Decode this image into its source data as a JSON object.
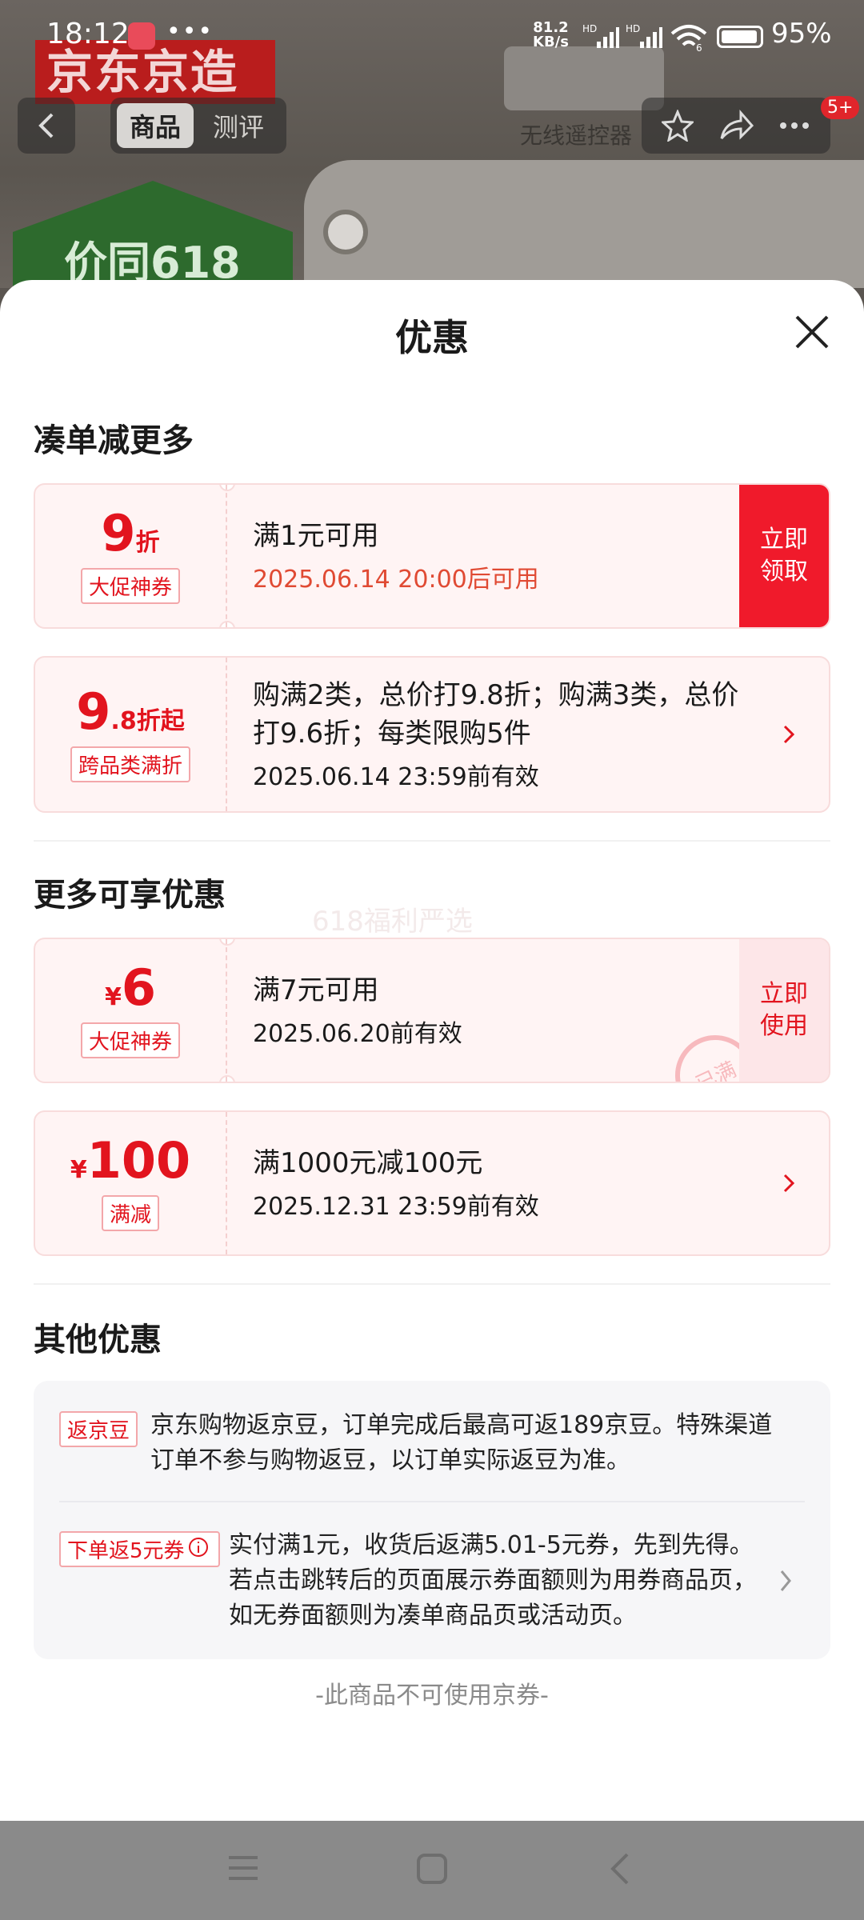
{
  "status_bar": {
    "time": "18:12",
    "more": "•••",
    "net_speed": "81.2",
    "net_unit": "KB/s",
    "signal_tag_1": "HD",
    "signal_tag_2": "HD",
    "wifi_level": "6",
    "battery": "95%"
  },
  "background": {
    "brand": "京东京造",
    "remote_label": "无线遥控器",
    "badge_text": "价同618"
  },
  "nav": {
    "tabs": [
      {
        "label": "商品"
      },
      {
        "label": "测评"
      }
    ],
    "notification_count": "5+"
  },
  "sheet": {
    "title": "优惠",
    "section_combine": "凑单减更多",
    "section_more": "更多可享优惠",
    "section_other": "其他优惠",
    "watermark": "618福利严选",
    "coupons": [
      {
        "value_big": "9",
        "value_small": "折",
        "tag": "大促神券",
        "main": "满1元可用",
        "sub": "2025.06.14 20:00后可用",
        "action": "立即领取"
      },
      {
        "value_big": "9",
        "value_small": ".8折起",
        "tag": "跨品类满折",
        "main": "购满2类，总价打9.8折；购满3类，总价打9.6折；每类限购5件",
        "sub": "2025.06.14 23:59前有效"
      },
      {
        "value_prefix": "¥",
        "value_big": "6",
        "tag": "大促神券",
        "main": "满7元可用",
        "sub": "2025.06.20前有效",
        "action": "立即使用",
        "stamp": "已满"
      },
      {
        "value_prefix": "¥",
        "value_big": "100",
        "tag": "满减",
        "main": "满1000元减100元",
        "sub": "2025.12.31 23:59前有效"
      }
    ],
    "other": [
      {
        "tag": "返京豆",
        "text": "京东购物返京豆，订单完成后最高可返189京豆。特殊渠道订单不参与购物返豆，以订单实际返豆为准。"
      },
      {
        "tag": "下单返5元券",
        "text": "实付满1元，收货后返满5.01-5元券，先到先得。若点击跳转后的页面展示券面额则为用券商品页，如无券面额则为凑单商品页或活动页。"
      }
    ],
    "footnote": "-此商品不可使用京券-"
  }
}
